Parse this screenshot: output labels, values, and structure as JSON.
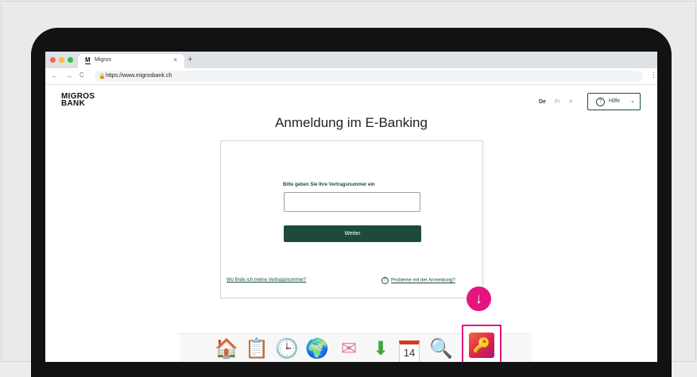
{
  "browser": {
    "tab_favicon": "M",
    "tab_title": "Migros",
    "tab_close": "×",
    "new_tab": "+",
    "back": "←",
    "forward": "→",
    "reload": "C",
    "lock_icon": "🔒",
    "url": "https://www.migrosbank.ch",
    "menu": "⋮",
    "window_dots": [
      "#ff5f57",
      "#febc2e",
      "#28c840"
    ]
  },
  "header": {
    "logo_line1": "MIGROS",
    "logo_line2": "BANK",
    "languages": [
      {
        "label": "De",
        "active": true
      },
      {
        "label": "Fr",
        "active": false
      },
      {
        "label": "It",
        "active": false
      }
    ],
    "help_label": "Hilfe",
    "help_icon": "?",
    "help_chevron": "⌄"
  },
  "main": {
    "title": "Anmeldung im E-Banking",
    "field_label": "Bitte geben Sie Ihre Vertragsnummer ein",
    "field_value": "",
    "submit_label": "Weiter",
    "link_contract": "Wo finde ich meine Vertragsnummer?",
    "link_problems": "Probleme mit der Anmeldung?",
    "link_problems_icon": "?"
  },
  "overlay": {
    "arrow_icon": "↓",
    "accent_color": "#e5157f"
  },
  "dock": {
    "items": [
      {
        "name": "home-icon",
        "glyph": "🏠"
      },
      {
        "name": "clipboard-icon",
        "glyph": "📋"
      },
      {
        "name": "clock-icon",
        "glyph": "🕒"
      },
      {
        "name": "globe-icon",
        "glyph": "🌍"
      },
      {
        "name": "mail-icon",
        "glyph": "✉"
      },
      {
        "name": "download-icon",
        "glyph": "⬇"
      },
      {
        "name": "calendar-icon",
        "glyph": "14"
      },
      {
        "name": "search-doc-icon",
        "glyph": "🔍"
      }
    ],
    "key_app_icon": "🔑"
  }
}
